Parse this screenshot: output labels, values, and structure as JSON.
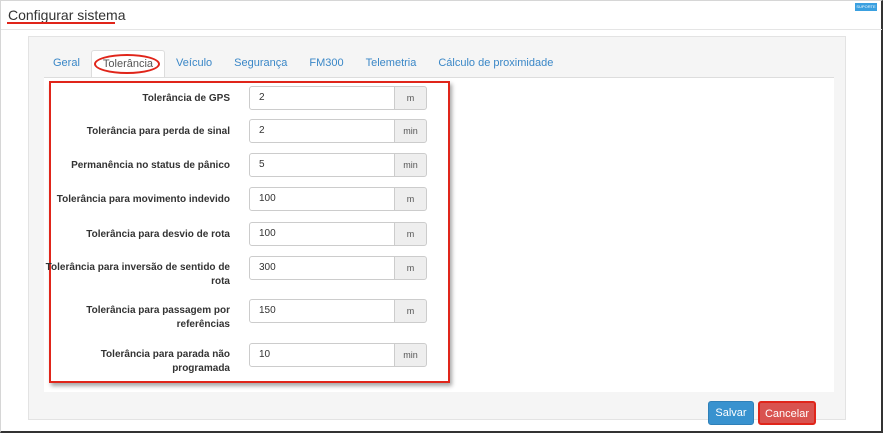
{
  "header": {
    "title": "Configurar sistema",
    "badge": "SUPORTE"
  },
  "tabs": [
    {
      "label": "Geral",
      "active": false
    },
    {
      "label": "Tolerância",
      "active": true
    },
    {
      "label": "Veículo",
      "active": false
    },
    {
      "label": "Segurança",
      "active": false
    },
    {
      "label": "FM300",
      "active": false
    },
    {
      "label": "Telemetria",
      "active": false
    },
    {
      "label": "Cálculo de proximidade",
      "active": false
    }
  ],
  "fields": [
    {
      "label": "Tolerância de GPS",
      "value": "2",
      "unit": "m"
    },
    {
      "label": "Tolerância para perda de sinal",
      "value": "2",
      "unit": "min"
    },
    {
      "label": "Permanência no status de pânico",
      "value": "5",
      "unit": "min"
    },
    {
      "label": "Tolerância para movimento indevido",
      "value": "100",
      "unit": "m"
    },
    {
      "label": "Tolerância para desvio de rota",
      "value": "100",
      "unit": "m"
    },
    {
      "label": "Tolerância para inversão de sentido de rota",
      "value": "300",
      "unit": "m"
    },
    {
      "label": "Tolerância para passagem por referências",
      "value": "150",
      "unit": "m"
    },
    {
      "label": "Tolerância para parada não programada",
      "value": "10",
      "unit": "min"
    }
  ],
  "actions": {
    "save_label": "Salvar",
    "cancel_label": "Cancelar"
  },
  "colors": {
    "annotation": "#e0251a",
    "link": "#3a87c7",
    "save": "#3892cf",
    "cancel": "#d9534f"
  }
}
